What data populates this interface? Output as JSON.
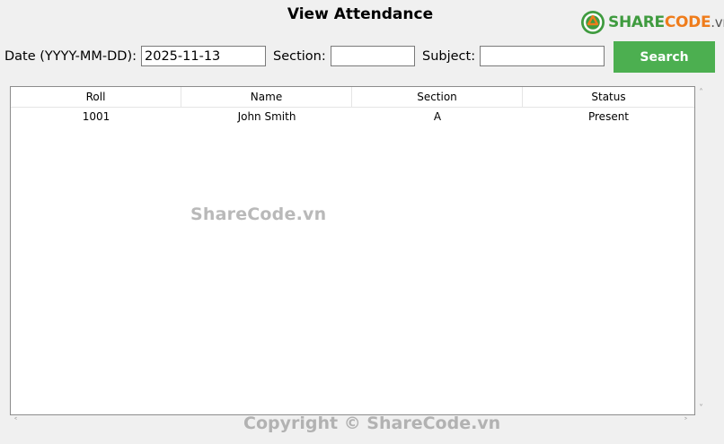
{
  "header": {
    "title": "View Attendance"
  },
  "logo": {
    "part1": "SHARE",
    "part2": "CODE",
    "part3": ".vn"
  },
  "filters": {
    "date_label": "Date (YYYY-MM-DD):",
    "date_value": "2025-11-13",
    "section_label": "Section:",
    "section_value": "",
    "subject_label": "Subject:",
    "subject_value": "",
    "search_label": "Search"
  },
  "table": {
    "columns": [
      "Roll",
      "Name",
      "Section",
      "Status"
    ],
    "rows": [
      {
        "roll": "1001",
        "name": "John Smith",
        "section": "A",
        "status": "Present"
      }
    ]
  },
  "watermark": {
    "center": "ShareCode.vn",
    "bottom": "Copyright © ShareCode.vn"
  },
  "colors": {
    "search_button": "#4caf50",
    "logo_green": "#3f9b3f",
    "logo_orange": "#ef7c1b"
  }
}
